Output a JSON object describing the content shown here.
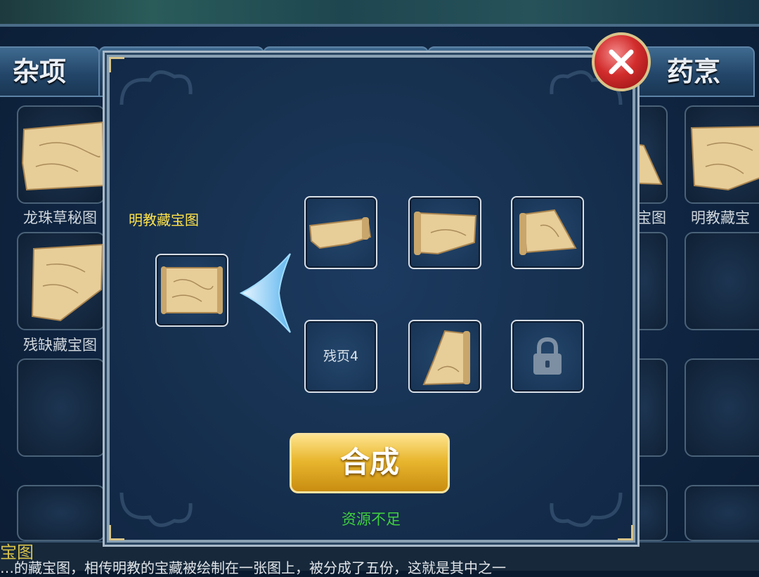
{
  "tabs": {
    "left_label": "杂项",
    "right_label": "药烹"
  },
  "grid": {
    "left_labels": [
      "龙珠草秘图",
      "残缺藏宝图"
    ],
    "right_labels": [
      "宝图",
      "明教藏宝"
    ]
  },
  "modal": {
    "target_name": "明教藏宝图",
    "fragment4_label": "残页4",
    "combine_label": "合成",
    "status_text": "资源不足"
  },
  "bottom": {
    "title": "宝图",
    "description": "…的藏宝图，相传明教的宝藏被绘制在一张图上，被分成了五份，这就是其中之一"
  },
  "colors": {
    "target_name": "#ffe24a",
    "status_text": "#3fcf3f",
    "combine_button": "#e9b730",
    "close_button": "#d22d2d"
  },
  "icons": [
    "close-icon",
    "arrow-left-icon",
    "lock-icon",
    "map-fragment-icon",
    "treasure-map-icon"
  ]
}
